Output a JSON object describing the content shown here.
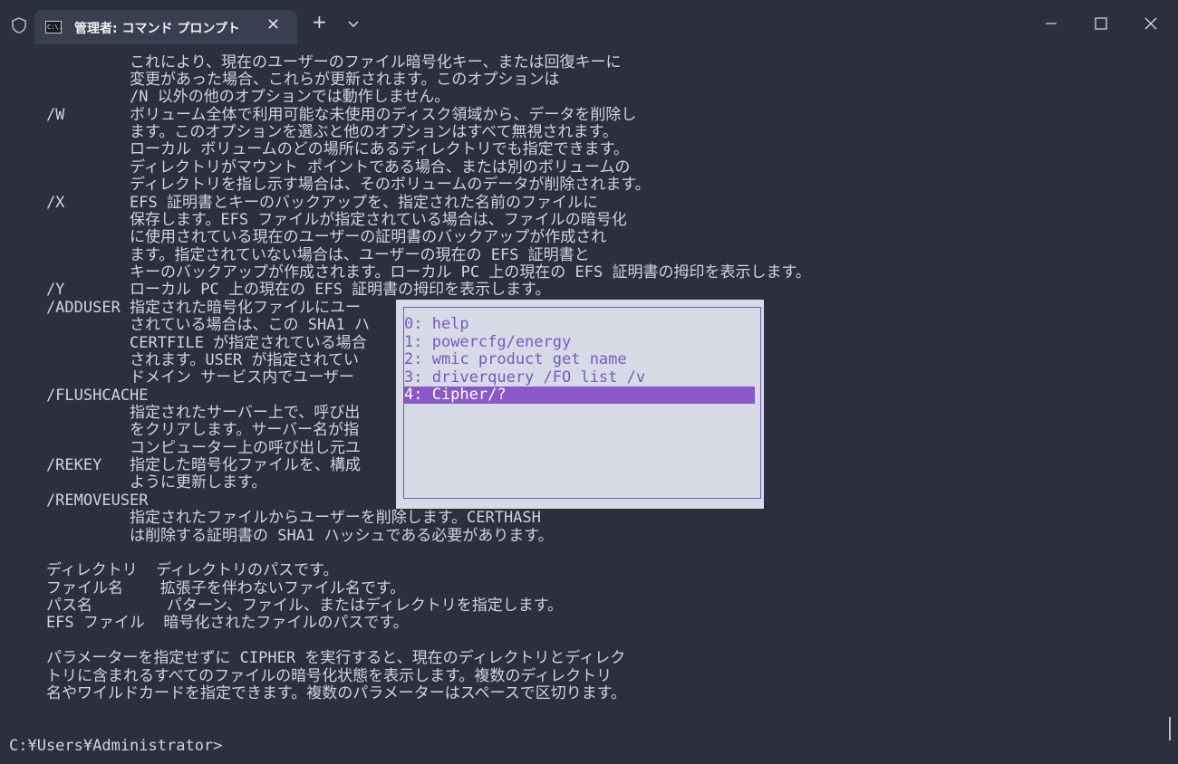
{
  "tab": {
    "title": "管理者: コマンド プロンプト",
    "icon_text": "C:\\."
  },
  "window": {
    "new_tab_label": "+"
  },
  "colors": {
    "background": "#2c2f3d",
    "text": "#cfd3e4",
    "popup_background": "#d6dbe6",
    "popup_text": "#7a55c6",
    "popup_selected": "#8a58c8"
  },
  "console_lines": [
    "             これにより、現在のユーザーのファイル暗号化キー、または回復キーに",
    "             変更があった場合、これらが更新されます。このオプションは",
    "             /N 以外の他のオプションでは動作しません。",
    "    /W       ボリューム全体で利用可能な未使用のディスク領域から、データを削除し",
    "             ます。このオプションを選ぶと他のオプションはすべて無視されます。",
    "             ローカル ボリュームのどの場所にあるディレクトリでも指定できます。",
    "             ディレクトリがマウント ポイントである場合、または別のボリュームの",
    "             ディレクトリを指し示す場合は、そのボリュームのデータが削除されます。",
    "    /X       EFS 証明書とキーのバックアップを、指定された名前のファイルに",
    "             保存します。EFS ファイルが指定されている場合は、ファイルの暗号化",
    "             に使用されている現在のユーザーの証明書のバックアップが作成され",
    "             ます。指定されていない場合は、ユーザーの現在の EFS 証明書と",
    "             キーのバックアップが作成されます。ローカル PC 上の現在の EFS 証明書の拇印を表示します。",
    "    /Y       ローカル PC 上の現在の EFS 証明書の拇印を表示します。",
    "    /ADDUSER 指定された暗号化ファイルにユー",
    "             されている場合は、この SHA1 ハ",
    "             CERTFILE が指定されている場合",
    "             されます。USER が指定されてい",
    "             ドメイン サービス内でユーザー",
    "    /FLUSHCACHE",
    "             指定されたサーバー上で、呼び出",
    "             をクリアします。サーバー名が指",
    "             コンピューター上の呼び出し元ユ",
    "    /REKEY   指定した暗号化ファイルを、構成",
    "             ように更新します。",
    "    /REMOVEUSER",
    "             指定されたファイルからユーザーを削除します。CERTHASH",
    "             は削除する証明書の SHA1 ハッシュである必要があります。",
    "",
    "    ディレクトリ  ディレクトリのパスです。",
    "    ファイル名    拡張子を伴わないファイル名です。",
    "    パス名        パターン、ファイル、またはディレクトリを指定します。",
    "    EFS ファイル  暗号化されたファイルのパスです。",
    "",
    "    パラメーターを指定せずに CIPHER を実行すると、現在のディレクトリとディレク",
    "    トリに含まれるすべてのファイルの暗号化状態を表示します。複数のディレクトリ",
    "    名やワイルドカードを指定できます。複数のパラメーターはスペースで区切ります。",
    "",
    "",
    "C:¥Users¥Administrator>"
  ],
  "history_popup": {
    "items": [
      "0: help",
      "1: powercfg/energy",
      "2: wmic product get name",
      "3: driverquery /FO list /v",
      "4: Cipher/?"
    ],
    "selected_index": 4
  }
}
